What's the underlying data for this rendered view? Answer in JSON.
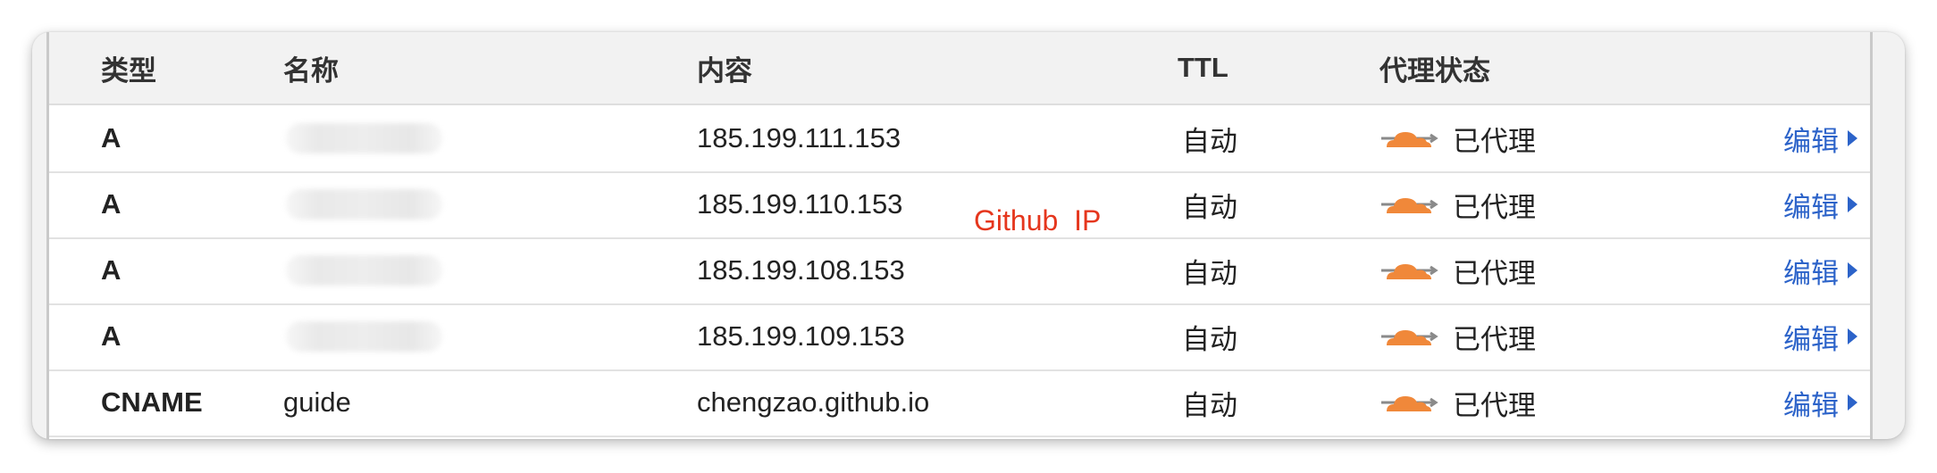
{
  "columns": {
    "type": "类型",
    "name": "名称",
    "content": "内容",
    "ttl": "TTL",
    "proxy": "代理状态"
  },
  "rows": [
    {
      "type": "A",
      "name": "",
      "content": "185.199.111.153",
      "ttl": "自动",
      "proxy": "已代理",
      "edit": "编辑"
    },
    {
      "type": "A",
      "name": "",
      "content": "185.199.110.153",
      "ttl": "自动",
      "proxy": "已代理",
      "edit": "编辑"
    },
    {
      "type": "A",
      "name": "",
      "content": "185.199.108.153",
      "ttl": "自动",
      "proxy": "已代理",
      "edit": "编辑"
    },
    {
      "type": "A",
      "name": "",
      "content": "185.199.109.153",
      "ttl": "自动",
      "proxy": "已代理",
      "edit": "编辑"
    },
    {
      "type": "CNAME",
      "name": "guide",
      "content": "chengzao.github.io",
      "ttl": "自动",
      "proxy": "已代理",
      "edit": "编辑"
    }
  ],
  "annotation": "Github  IP",
  "colors": {
    "cloud": "#f0883a",
    "arrow": "#8a8a8a",
    "edit_link": "#2c63c9",
    "annotation": "#e5361d"
  },
  "icons": {
    "proxy_status": "orange-cloud-proxied-icon",
    "edit_arrow": "caret-right-icon"
  }
}
